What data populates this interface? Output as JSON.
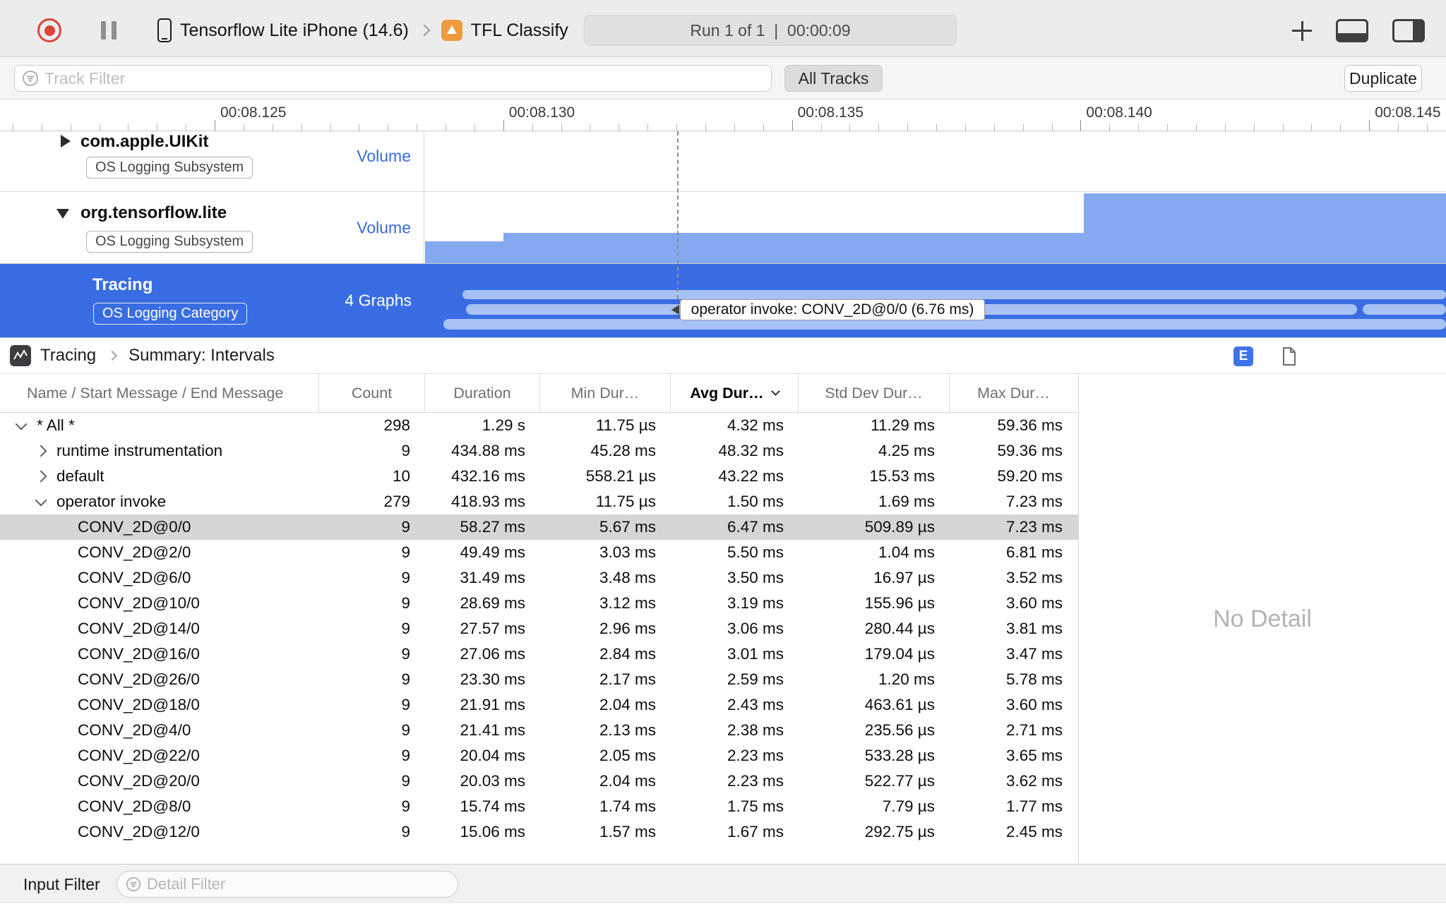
{
  "toolbar": {
    "device_label": "Tensorflow Lite iPhone (14.6)",
    "process_label": "TFL Classify",
    "status": "Run 1 of 1  |  00:00:09"
  },
  "filter_bar": {
    "track_filter_placeholder": "Track Filter",
    "all_tracks_label": "All Tracks",
    "duplicate_label": "Duplicate"
  },
  "ruler": {
    "labels": [
      "00:08.125",
      "00:08.130",
      "00:08.135",
      "00:08.140",
      "00:08.145"
    ]
  },
  "tracks": [
    {
      "title": "com.apple.UIKit",
      "badge": "OS Logging Subsystem",
      "meta": "Volume",
      "disclosure": "collapsed"
    },
    {
      "title": "org.tensorflow.lite",
      "badge": "OS Logging Subsystem",
      "meta": "Volume",
      "disclosure": "expanded"
    },
    {
      "title": "Tracing",
      "badge": "OS Logging Category",
      "meta": "4 Graphs",
      "selected": true,
      "tooltip": "operator invoke: CONV_2D@0/0 (6.76 ms)"
    }
  ],
  "breadcrumb": {
    "items": [
      "Tracing",
      "Summary: Intervals"
    ]
  },
  "detail_panel": {
    "edit_button": "E",
    "message": "No Detail"
  },
  "table": {
    "columns": [
      {
        "label": "Name / Start Message / End Message"
      },
      {
        "label": "Count"
      },
      {
        "label": "Duration"
      },
      {
        "label": "Min Dur…"
      },
      {
        "label": "Avg Dur…",
        "sorted": true,
        "sort_direction": "desc"
      },
      {
        "label": "Std Dev Dur…"
      },
      {
        "label": "Max Dur…"
      }
    ],
    "rows": [
      {
        "name": "* All *",
        "depth": 0,
        "disclosure": "expanded",
        "count": "298",
        "duration": "1.29 s",
        "min": "11.75 µs",
        "avg": "4.32 ms",
        "std_dev": "11.29 ms",
        "max": "59.36 ms"
      },
      {
        "name": "runtime instrumentation",
        "depth": 1,
        "disclosure": "collapsed",
        "count": "9",
        "duration": "434.88 ms",
        "min": "45.28 ms",
        "avg": "48.32 ms",
        "std_dev": "4.25 ms",
        "max": "59.36 ms"
      },
      {
        "name": "default",
        "depth": 1,
        "disclosure": "collapsed",
        "count": "10",
        "duration": "432.16 ms",
        "min": "558.21 µs",
        "avg": "43.22 ms",
        "std_dev": "15.53 ms",
        "max": "59.20 ms"
      },
      {
        "name": "operator invoke",
        "depth": 1,
        "disclosure": "expanded",
        "count": "279",
        "duration": "418.93 ms",
        "min": "11.75 µs",
        "avg": "1.50 ms",
        "std_dev": "1.69 ms",
        "max": "7.23 ms"
      },
      {
        "name": "CONV_2D@0/0",
        "depth": 2,
        "selected": true,
        "count": "9",
        "duration": "58.27 ms",
        "min": "5.67 ms",
        "avg": "6.47 ms",
        "std_dev": "509.89 µs",
        "max": "7.23 ms"
      },
      {
        "name": "CONV_2D@2/0",
        "depth": 2,
        "count": "9",
        "duration": "49.49 ms",
        "min": "3.03 ms",
        "avg": "5.50 ms",
        "std_dev": "1.04 ms",
        "max": "6.81 ms"
      },
      {
        "name": "CONV_2D@6/0",
        "depth": 2,
        "count": "9",
        "duration": "31.49 ms",
        "min": "3.48 ms",
        "avg": "3.50 ms",
        "std_dev": "16.97 µs",
        "max": "3.52 ms"
      },
      {
        "name": "CONV_2D@10/0",
        "depth": 2,
        "count": "9",
        "duration": "28.69 ms",
        "min": "3.12 ms",
        "avg": "3.19 ms",
        "std_dev": "155.96 µs",
        "max": "3.60 ms"
      },
      {
        "name": "CONV_2D@14/0",
        "depth": 2,
        "count": "9",
        "duration": "27.57 ms",
        "min": "2.96 ms",
        "avg": "3.06 ms",
        "std_dev": "280.44 µs",
        "max": "3.81 ms"
      },
      {
        "name": "CONV_2D@16/0",
        "depth": 2,
        "count": "9",
        "duration": "27.06 ms",
        "min": "2.84 ms",
        "avg": "3.01 ms",
        "std_dev": "179.04 µs",
        "max": "3.47 ms"
      },
      {
        "name": "CONV_2D@26/0",
        "depth": 2,
        "count": "9",
        "duration": "23.30 ms",
        "min": "2.17 ms",
        "avg": "2.59 ms",
        "std_dev": "1.20 ms",
        "max": "5.78 ms"
      },
      {
        "name": "CONV_2D@18/0",
        "depth": 2,
        "count": "9",
        "duration": "21.91 ms",
        "min": "2.04 ms",
        "avg": "2.43 ms",
        "std_dev": "463.61 µs",
        "max": "3.60 ms"
      },
      {
        "name": "CONV_2D@4/0",
        "depth": 2,
        "count": "9",
        "duration": "21.41 ms",
        "min": "2.13 ms",
        "avg": "2.38 ms",
        "std_dev": "235.56 µs",
        "max": "2.71 ms"
      },
      {
        "name": "CONV_2D@22/0",
        "depth": 2,
        "count": "9",
        "duration": "20.04 ms",
        "min": "2.05 ms",
        "avg": "2.23 ms",
        "std_dev": "533.28 µs",
        "max": "3.65 ms"
      },
      {
        "name": "CONV_2D@20/0",
        "depth": 2,
        "count": "9",
        "duration": "20.03 ms",
        "min": "2.04 ms",
        "avg": "2.23 ms",
        "std_dev": "522.77 µs",
        "max": "3.62 ms"
      },
      {
        "name": "CONV_2D@8/0",
        "depth": 2,
        "count": "9",
        "duration": "15.74 ms",
        "min": "1.74 ms",
        "avg": "1.75 ms",
        "std_dev": "7.79 µs",
        "max": "1.77 ms"
      },
      {
        "name": "CONV_2D@12/0",
        "depth": 2,
        "count": "9",
        "duration": "15.06 ms",
        "min": "1.57 ms",
        "avg": "1.67 ms",
        "std_dev": "292.75 µs",
        "max": "2.45 ms"
      }
    ]
  },
  "bottom_bar": {
    "input_filter_label": "Input Filter",
    "detail_filter_placeholder": "Detail Filter"
  }
}
